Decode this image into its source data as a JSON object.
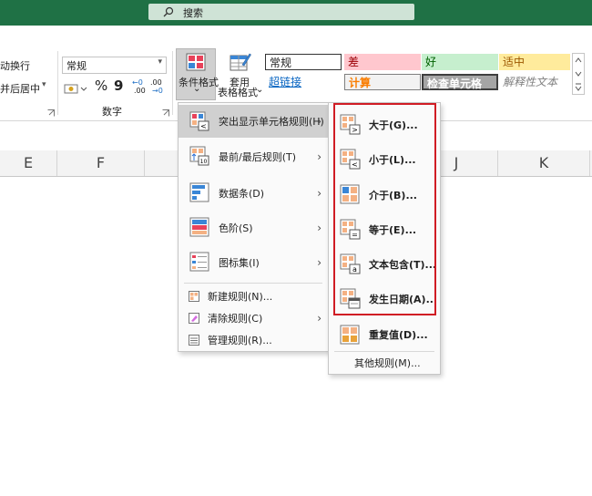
{
  "search": {
    "label": "搜索"
  },
  "ribbon": {
    "wrap_text": "动换行",
    "merge_center": "并后居中",
    "merge_arrow": "▾",
    "number_format": "常规",
    "number_format_arrow": "▾",
    "percent": "%",
    "comma": "9",
    "increase_decimal_top": "←0",
    "increase_decimal_bot": ".00",
    "decrease_decimal_top": ".00",
    "decrease_decimal_bot": "→0",
    "number_group_label": "数字",
    "conditional_format_label": "条件格式",
    "conditional_format_arrow": "⌄",
    "table_format_line1": "套用",
    "table_format_line2": "表格格式",
    "table_format_arrow": "⌄",
    "styles": [
      {
        "label": "常规",
        "bg": "#ffffff",
        "color": "#000000"
      },
      {
        "label": "差",
        "bg": "#ffc7ce",
        "color": "#9c0006"
      },
      {
        "label": "好",
        "bg": "#c6efce",
        "color": "#006100"
      },
      {
        "label": "适中",
        "bg": "#ffeb9c",
        "color": "#9c5700"
      },
      {
        "label": "超链接",
        "bg": "#ffffff",
        "color": "#0563c1"
      },
      {
        "label": "计算",
        "bg": "#f2f2f2",
        "color": "#fa7d00"
      },
      {
        "label": "检查单元格",
        "bg": "#a5a5a5",
        "color": "#ffffff"
      },
      {
        "label": "解释性文本",
        "bg": "#ffffff",
        "color": "#7f7f7f"
      }
    ]
  },
  "columns": [
    "E",
    "F",
    "J",
    "K"
  ],
  "main_menu": {
    "items": [
      {
        "label": "突出显示单元格规则(H)",
        "has_sub": true
      },
      {
        "label": "最前/最后规则(T)",
        "has_sub": true
      },
      {
        "label": "数据条(D)",
        "has_sub": true
      },
      {
        "label": "色阶(S)",
        "has_sub": true
      },
      {
        "label": "图标集(I)",
        "has_sub": true
      }
    ],
    "footer": [
      {
        "label": "新建规则(N)...",
        "has_sub": false
      },
      {
        "label": "清除规则(C)",
        "has_sub": true
      },
      {
        "label": "管理规则(R)...",
        "has_sub": false
      }
    ]
  },
  "sub_menu": {
    "items": [
      {
        "label": "大于(G)..."
      },
      {
        "label": "小于(L)..."
      },
      {
        "label": "介于(B)..."
      },
      {
        "label": "等于(E)..."
      },
      {
        "label": "文本包含(T)..."
      },
      {
        "label": "发生日期(A)..."
      },
      {
        "label": "重复值(D)..."
      }
    ],
    "more": "其他规则(M)..."
  },
  "glyphs": {
    "chevron": "›",
    "icon10": "10",
    "gt": ">",
    "lt": "<",
    "eq": "=",
    "a": "a"
  },
  "colors": {
    "accent_green": "#1f7145",
    "highlight_red": "#d01c24"
  }
}
